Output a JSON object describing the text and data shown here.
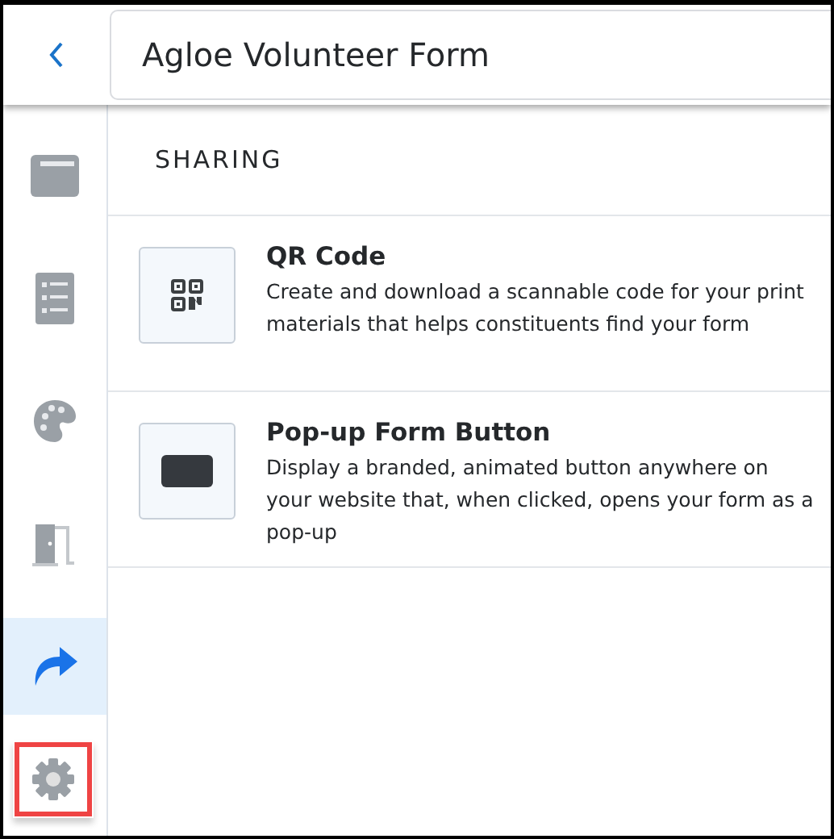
{
  "header": {
    "title": "Agloe Volunteer Form"
  },
  "sidebar": {
    "items": [
      {
        "kind": "layout",
        "selected": false,
        "highlighted": false
      },
      {
        "kind": "list",
        "selected": false,
        "highlighted": false
      },
      {
        "kind": "palette",
        "selected": false,
        "highlighted": false
      },
      {
        "kind": "door",
        "selected": false,
        "highlighted": false
      },
      {
        "kind": "share",
        "selected": true,
        "highlighted": false
      },
      {
        "kind": "settings",
        "selected": false,
        "highlighted": true
      }
    ]
  },
  "section": {
    "heading": "SHARING"
  },
  "options": [
    {
      "kind": "qr",
      "title": "QR Code",
      "description": "Create and download a scannable code for your print materials that helps constituents find your form"
    },
    {
      "kind": "popup",
      "title": "Pop-up Form Button",
      "description": "Display a branded, animated button anywhere on your website that, when clicked, opens your form as a pop-up"
    }
  ]
}
